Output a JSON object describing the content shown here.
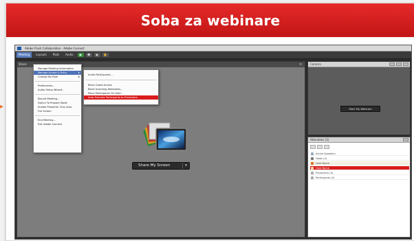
{
  "page": {
    "banner_title": "Soba za webinare"
  },
  "app": {
    "window_title": "Adobe Flash Collaboration - Adobe Connect",
    "menubar": [
      "Meeting",
      "Layouts",
      "Pods",
      "Audio"
    ],
    "share_pod": {
      "label": "Share",
      "button_label": "Share My Screen"
    },
    "meeting_menu": {
      "items": [
        "Manage Meeting Information",
        "Manage Access & Entry",
        "Change My Role",
        "Preferences...",
        "Audio Setup Wizard...",
        "Record Meeting...",
        "Switch To Prepare Mode",
        "Enable Presenter Only Area",
        "Full Screen",
        "End Meeting...",
        "Exit Adobe Connect"
      ],
      "highlighted_index": 1
    },
    "access_submenu": {
      "items": [
        "Invite Participants...",
        "Block Guest Access",
        "Block Incoming Attendees...",
        "Place Participants On Hold...",
        "Auto-Promote Participants to Presenters"
      ],
      "highlighted_index": 4
    },
    "camera_pod": {
      "title": "Camera",
      "button_label": "Start My Webcam"
    },
    "attendees_pod": {
      "title": "Attendees (3)",
      "rows": [
        "Active Speakers",
        "Hosts (2)",
        "Host Name",
        "Host Name",
        "Presenters (0)",
        "Participants (0)"
      ],
      "highlighted_index": 3
    }
  },
  "colors": {
    "banner_red": "#d41f1f",
    "highlight_blue": "#4f74b8",
    "highlight_red": "#d91c1c",
    "share_bg": "#7d7d7d"
  },
  "icons": [
    "app-logo-icon",
    "share-screen-icon",
    "chevron-right-icon",
    "dropdown-arrow-icon",
    "user-icon",
    "arrow-marker-icon"
  ]
}
